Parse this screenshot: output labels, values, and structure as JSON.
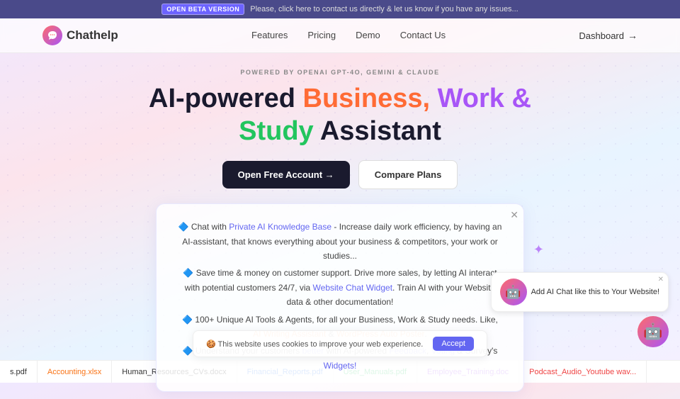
{
  "banner": {
    "badge": "OPEN BETA VERSION",
    "message": "Please, click here to contact us directly & let us know if you have any issues..."
  },
  "navbar": {
    "logo_text": "Chathelp",
    "links": [
      {
        "label": "Features"
      },
      {
        "label": "Pricing"
      },
      {
        "label": "Demo"
      },
      {
        "label": "Contact Us"
      }
    ],
    "dashboard_label": "Dashboard"
  },
  "hero": {
    "powered_by": "POWERED BY OPENAI GPT-4O, GEMINI & CLAUDE",
    "title_prefix": "AI-powered ",
    "title_business": "Business,",
    "title_work": "Work &",
    "title_study": "Study",
    "title_suffix": " Assistant",
    "btn_open": "Open Free Account →",
    "btn_compare": "Compare Plans"
  },
  "card": {
    "lines": [
      "🔷 Chat with Private AI Knowledge Base - Increase daily work efficiency, by having an AI-assistant, that knows everything about your business & competitors, your work or studies...",
      "🔷 Save time & money on customer support. Drive more sales, by letting AI interact with potential customers 24/7, via Website Chat Widget. Train AI with your Website data & other documentation!",
      "🔷 100+ Unique AI Tools & Agents, for all your Business, Work & Study needs. Like, AI Writing Assistant & WordPress Auto Poster.",
      "🔷 Understand your customers better with AI-powered Feedback, Voting & Survey's Widgets!"
    ]
  },
  "cookie": {
    "message": "🍪 This website uses cookies to improve your web experience.",
    "accept": "Accept"
  },
  "bottom_tags": [
    {
      "label": "s.pdf",
      "color": "default"
    },
    {
      "label": "Accounting.xlsx",
      "color": "orange"
    },
    {
      "label": "Human_Resources_CVs.docx",
      "color": "default"
    },
    {
      "label": "Financial_Reports.pdf",
      "color": "blue"
    },
    {
      "label": "User_Manuals.pdf",
      "color": "green"
    },
    {
      "label": "Employee_Training.doc",
      "color": "purple"
    },
    {
      "label": "Podcast_Audio_Youtube wav...",
      "color": "red"
    }
  ],
  "chat_widget": {
    "bubble_text": "Add AI Chat like this to Your Website!",
    "icon": "🤖"
  },
  "icons": {
    "logo": "💬",
    "close": "✕",
    "star": "✦",
    "robot": "🤖"
  }
}
